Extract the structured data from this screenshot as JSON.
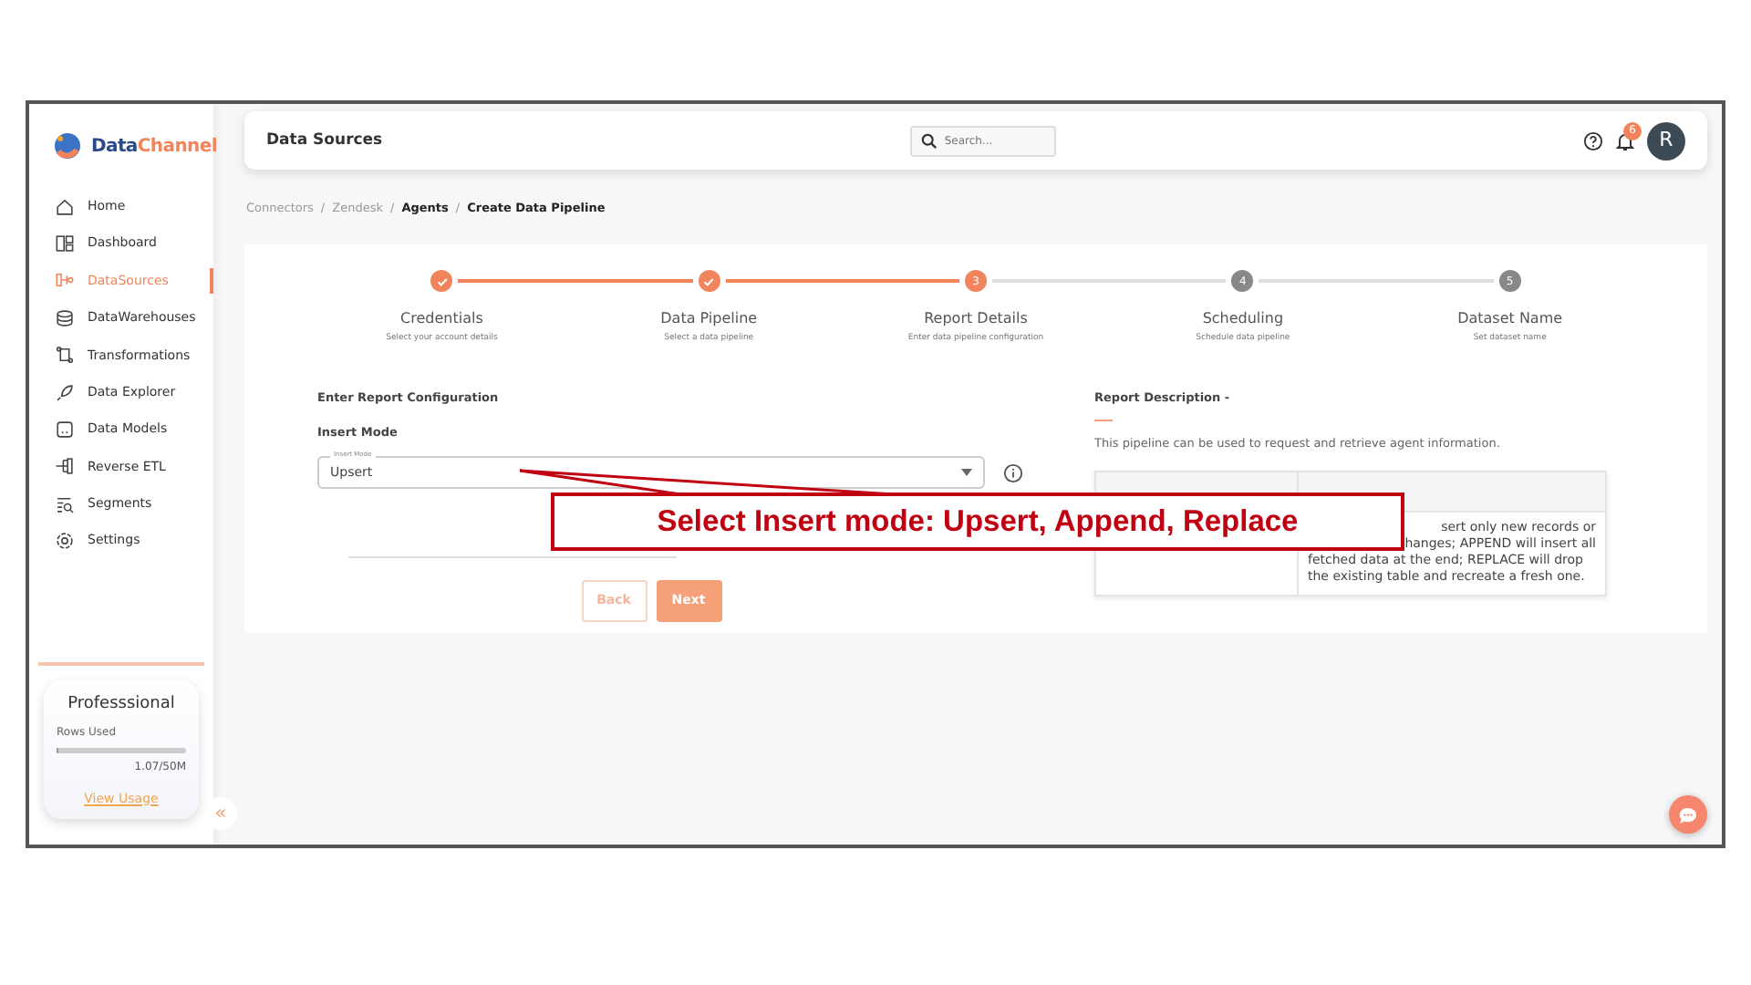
{
  "brand": {
    "name_part1": "Data",
    "name_part2": "Channel"
  },
  "sidebar": {
    "items": [
      {
        "label": "Home",
        "selected": false
      },
      {
        "label": "Dashboard",
        "selected": false
      },
      {
        "label": "DataSources",
        "selected": true
      },
      {
        "label": "DataWarehouses",
        "selected": false
      },
      {
        "label": "Transformations",
        "selected": false
      },
      {
        "label": "Data Explorer",
        "selected": false
      },
      {
        "label": "Data Models",
        "selected": false
      },
      {
        "label": "Reverse ETL",
        "selected": false
      },
      {
        "label": "Segments",
        "selected": false
      },
      {
        "label": "Settings",
        "selected": false
      }
    ],
    "plan": {
      "name": "Professsional",
      "usage_label": "Rows Used",
      "level": 0.02,
      "reading": "1.07/50M",
      "link": "View Usage"
    },
    "collapse": "«"
  },
  "header": {
    "title": "Data Sources",
    "search": {
      "placeholder": "Search..."
    },
    "notifications": "6",
    "avatar": "R"
  },
  "breadcrumb": [
    {
      "label": "Connectors",
      "current": false
    },
    {
      "separator_before": "/",
      "label": "Zendesk",
      "current": false
    },
    {
      "separator_before": "/",
      "label": "Agents",
      "current": true
    },
    {
      "separator_before": "/",
      "label": "Create Data Pipeline",
      "current": true
    }
  ],
  "steps": [
    {
      "title": "Credentials",
      "subtitle": "Select your account details",
      "completed": true,
      "reached": true
    },
    {
      "title": "Data Pipeline",
      "subtitle": "Select a data pipeline",
      "completed": true,
      "reached": true
    },
    {
      "title": "Report Details",
      "subtitle": "Enter data pipeline configuration",
      "completed": false,
      "reached": true,
      "number": "3"
    },
    {
      "title": "Scheduling",
      "subtitle": "Schedule data pipeline",
      "completed": false,
      "reached": false,
      "number": "4"
    },
    {
      "title": "Dataset Name",
      "subtitle": "Set dataset name",
      "completed": false,
      "reached": false,
      "number": "5"
    }
  ],
  "form": {
    "heading": "Enter Report Configuration",
    "field_label": "Insert Mode",
    "select": {
      "floating_label": "Insert Mode",
      "value": "Upsert"
    },
    "buttons": [
      {
        "label": "Back",
        "kind": "outline"
      },
      {
        "label": "Next",
        "kind": "primary"
      }
    ]
  },
  "report": {
    "heading": "Report Description -",
    "text": "This pipeline can be used to request and retrieve agent information.",
    "description_partial_lines": [
      "sert only new records or",
      "hanges; APPEND will insert all"
    ],
    "description_lines": [
      "fetched data at the end; REPLACE will drop",
      "the existing table and recreate a fresh one."
    ]
  },
  "callout": {
    "text": "Select Insert mode: Upsert, Append, Replace"
  }
}
